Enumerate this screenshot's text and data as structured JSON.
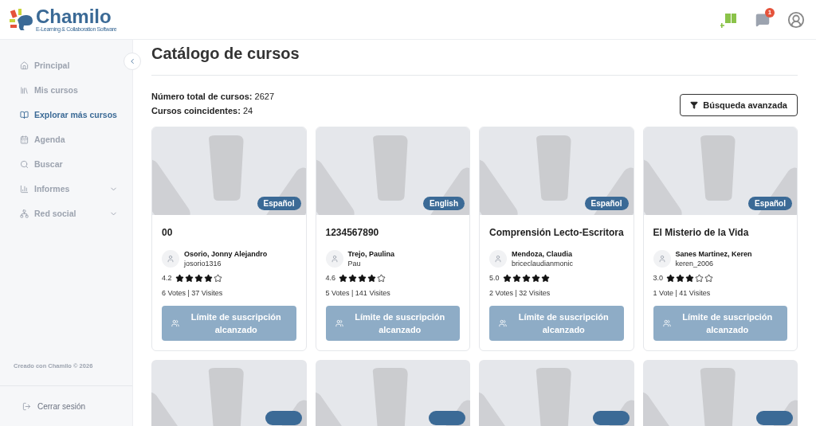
{
  "header": {
    "logo": "Chamilo",
    "tagline": "E-Learning & Collaboration Software",
    "notification_count": "1"
  },
  "sidebar": {
    "items": [
      {
        "label": "Principal",
        "selected": false
      },
      {
        "label": "Mis cursos",
        "selected": false
      },
      {
        "label": "Explorar más cursos",
        "selected": true
      },
      {
        "label": "Agenda",
        "selected": false
      },
      {
        "label": "Buscar",
        "selected": false
      },
      {
        "label": "Informes",
        "selected": false,
        "expanded": false
      },
      {
        "label": "Red social",
        "selected": false,
        "expanded": false
      }
    ],
    "footer": "Creado con Chamilo © 2026",
    "logout": "Cerrar sesión"
  },
  "page": {
    "title": "Catálogo de cursos",
    "stats": [
      "**Número total de cursos:** 2627",
      "**Cursos coincidentes:** 24"
    ],
    "advanced_search": "Búsqueda avanzada"
  },
  "cards": [
    {
      "kind": "full",
      "language": "Español",
      "title": "00",
      "author": "Osorio, Jonny Alejandro",
      "username": "josorio1316",
      "rating": "4.2",
      "stars": 4,
      "stats": "6 Votes | 37 Visites",
      "button": "Límite de suscripción alcanzado"
    },
    {
      "kind": "full",
      "language": "English",
      "title": "1234567890",
      "author": "Trejo, Paulina",
      "username": "Pau",
      "rating": "4.6",
      "stars": 4,
      "stats": "5 Votes | 141 Visites",
      "button": "Límite de suscripción alcanzado"
    },
    {
      "kind": "full",
      "language": "Español",
      "title": "Comprensión Lecto-Escritora",
      "author": "Mendoza, Claudia",
      "username": "briceclaudianmonic",
      "rating": "5.0",
      "stars": 5,
      "stats": "2 Votes | 32 Visites",
      "button": "Límite de suscripción alcanzado"
    },
    {
      "kind": "full",
      "language": "Español",
      "title": "El Misterio de la Vida",
      "author": "Sanes Martinez, Keren",
      "username": "keren_2006",
      "rating": "3.0",
      "stars": 3,
      "stats": "1 Vote | 41 Visites",
      "button": "Límite de suscripción alcanzado"
    },
    {
      "kind": "partial"
    },
    {
      "kind": "partial"
    },
    {
      "kind": "partial"
    },
    {
      "kind": "partial"
    }
  ]
}
